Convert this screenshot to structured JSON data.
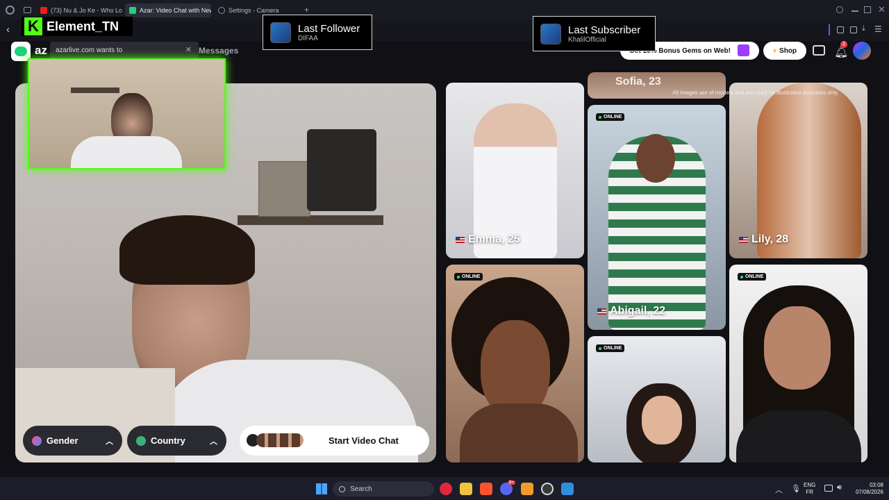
{
  "browser": {
    "tabs": [
      {
        "label": "(73) Nu & Jo Ke - Who Love",
        "favicon_color": "#e62117"
      },
      {
        "label": "Azar: Video Chat with New",
        "favicon_color": "#21d07a"
      },
      {
        "label": "Settings - Camera",
        "favicon_color": "#8a8d99"
      }
    ],
    "new_tab": "+"
  },
  "stream_overlay": {
    "channel_name": "Element_TN",
    "last_follower_title": "Last Follower",
    "last_follower_name": "DIFAA",
    "last_subscriber_title": "Last Subscriber",
    "last_subscriber_name": "KhalilOfficial"
  },
  "permission_popup": {
    "text": "azarlive.com wants to"
  },
  "site": {
    "logo_text": "az",
    "nav_messages": "Messages",
    "promo": "Get 10% Bonus Gems on Web!",
    "shop": "Shop",
    "notification_count": "2",
    "disclaimer": "All images are of models and are used for illustrative purposes only."
  },
  "controls": {
    "gender_label": "Gender",
    "country_label": "Country",
    "start_label": "Start Video Chat"
  },
  "cards": [
    {
      "name": "Emma, 25",
      "online": ""
    },
    {
      "name": "Sofia, 23",
      "online": ""
    },
    {
      "name": "Abigail, 22",
      "online": "ONLINE"
    },
    {
      "name": "Lily, 28",
      "online": ""
    },
    {
      "name": "",
      "online": "ONLINE"
    },
    {
      "name": "",
      "online": "ONLINE"
    },
    {
      "name": "",
      "online": "ONLINE"
    }
  ],
  "taskbar": {
    "search": "Search",
    "lang_top": "ENG",
    "lang_bottom": "FR",
    "time": "03:08",
    "date": "07/08/2026",
    "discord_badge": "9+"
  },
  "colors": {
    "accent_green": "#53fc18",
    "azar_green": "#21d07a",
    "online_dot": "#2ee07a"
  }
}
